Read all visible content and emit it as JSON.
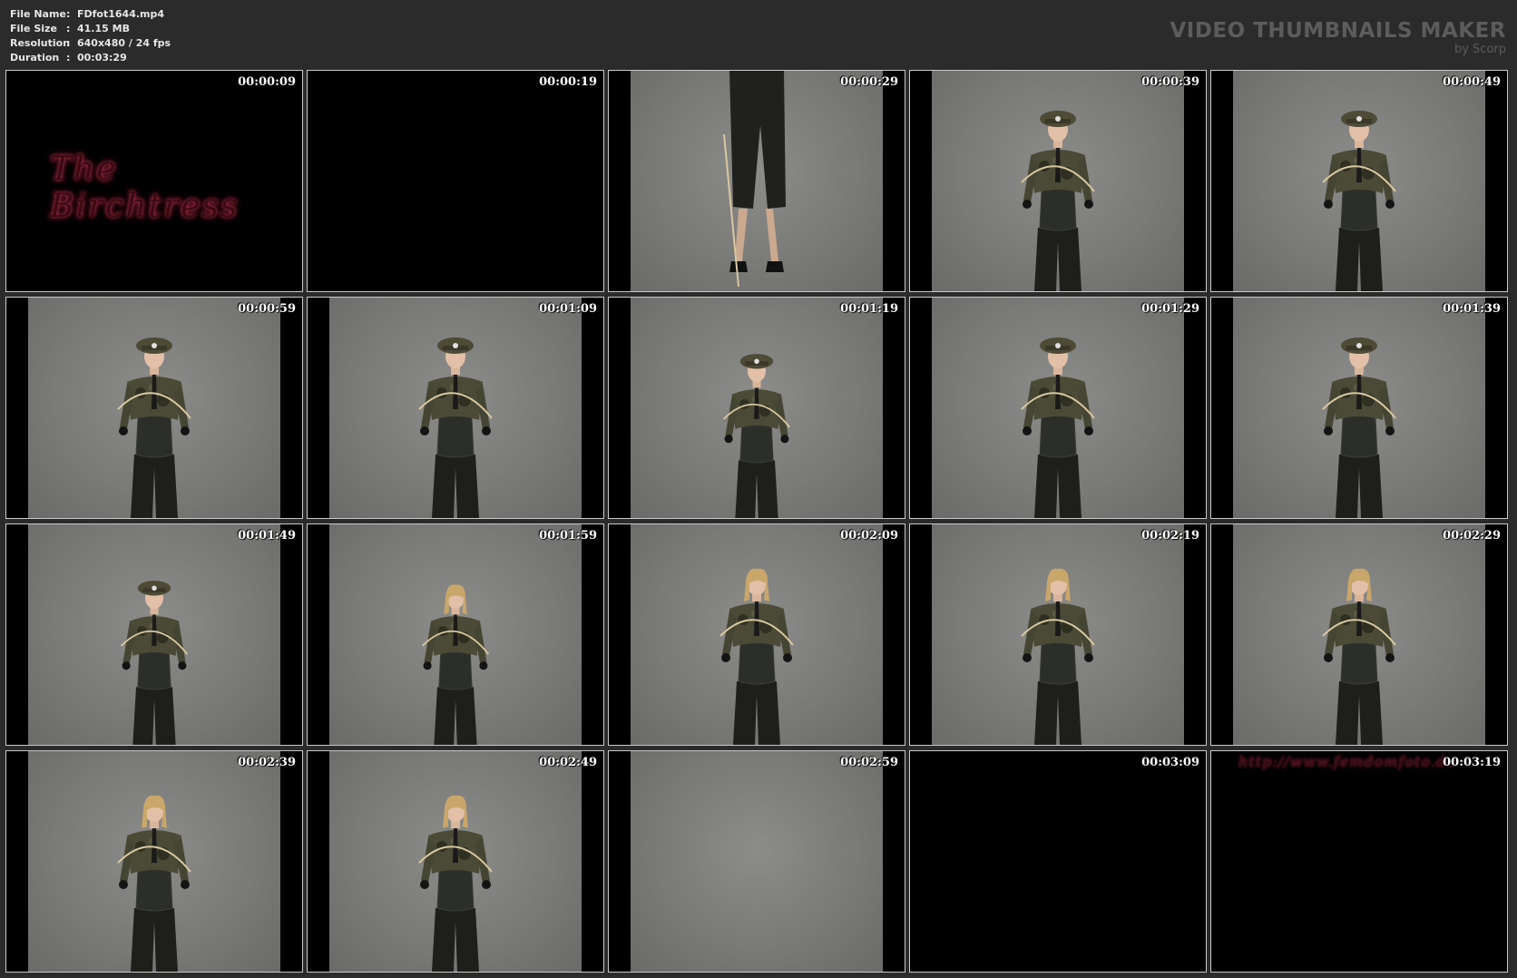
{
  "info": {
    "file_name_label": "File Name",
    "file_name_value": "FDfot1644.mp4",
    "file_size_label": "File Size",
    "file_size_value": "41.15 MB",
    "resolution_label": "Resolution",
    "resolution_value": "640x480 / 24 fps",
    "duration_label": "Duration",
    "duration_value": "00:03:29",
    "separator": ":"
  },
  "watermark": {
    "title": "VIDEO THUMBNAILS MAKER",
    "subtitle": "by Scorp"
  },
  "thumbnails": [
    {
      "time": "00:00:09",
      "kind": "title",
      "overlay": "The Birchtress"
    },
    {
      "time": "00:00:19",
      "kind": "black"
    },
    {
      "time": "00:00:29",
      "kind": "legs"
    },
    {
      "time": "00:00:39",
      "kind": "figure-cap"
    },
    {
      "time": "00:00:49",
      "kind": "figure-cap"
    },
    {
      "time": "00:00:59",
      "kind": "figure-cap"
    },
    {
      "time": "00:01:09",
      "kind": "figure-cap"
    },
    {
      "time": "00:01:19",
      "kind": "figure-cap-small"
    },
    {
      "time": "00:01:29",
      "kind": "figure-cap"
    },
    {
      "time": "00:01:39",
      "kind": "figure-cap"
    },
    {
      "time": "00:01:49",
      "kind": "figure-cap-small"
    },
    {
      "time": "00:01:59",
      "kind": "figure-hair-small"
    },
    {
      "time": "00:02:09",
      "kind": "figure-hair"
    },
    {
      "time": "00:02:19",
      "kind": "figure-hair"
    },
    {
      "time": "00:02:29",
      "kind": "figure-hair"
    },
    {
      "time": "00:02:39",
      "kind": "figure-hair"
    },
    {
      "time": "00:02:49",
      "kind": "figure-hair"
    },
    {
      "time": "00:02:59",
      "kind": "empty"
    },
    {
      "time": "00:03:09",
      "kind": "black"
    },
    {
      "time": "00:03:19",
      "kind": "url",
      "overlay": "http://www.femdomfoto.de"
    }
  ]
}
